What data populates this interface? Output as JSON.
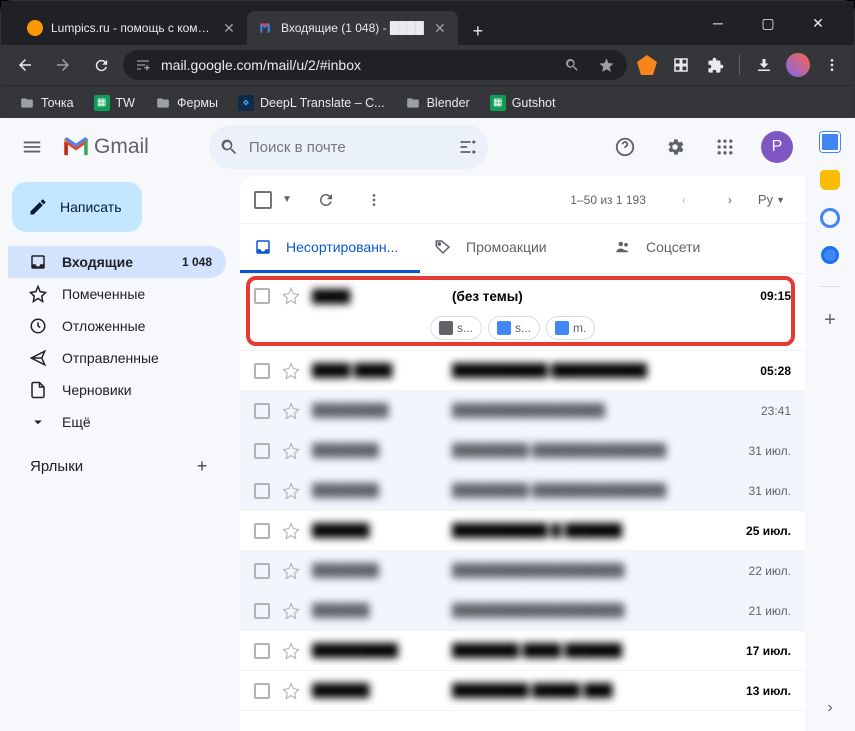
{
  "browser": {
    "tabs": [
      {
        "title": "Lumpics.ru - помощь с компью",
        "favicon": "#ff9800",
        "active": false
      },
      {
        "title": "Входящие (1 048) - ████",
        "favicon": "gmail",
        "active": true
      }
    ],
    "url": "mail.googlе.com/mail/u/2/#inbox",
    "bookmarks": [
      {
        "label": "Точка",
        "type": "folder"
      },
      {
        "label": "TW",
        "type": "sheet"
      },
      {
        "label": "Фермы",
        "type": "folder"
      },
      {
        "label": "DeepL Translate – С...",
        "type": "deepl"
      },
      {
        "label": "Blender",
        "type": "folder"
      },
      {
        "label": "Gutshot",
        "type": "sheet"
      }
    ]
  },
  "gmail": {
    "logo_text": "Gmail",
    "search_placeholder": "Поиск в почте",
    "compose_label": "Написать",
    "avatar_letter": "P",
    "nav": [
      {
        "icon": "inbox",
        "label": "Входящие",
        "count": "1 048",
        "active": true
      },
      {
        "icon": "star",
        "label": "Помеченные"
      },
      {
        "icon": "clock",
        "label": "Отложенные"
      },
      {
        "icon": "send",
        "label": "Отправленные"
      },
      {
        "icon": "draft",
        "label": "Черновики"
      },
      {
        "icon": "more",
        "label": "Ещё"
      }
    ],
    "labels_header": "Ярлыки",
    "pager_text": "1–50 из 1 193",
    "lang_label": "Ру",
    "categories": [
      {
        "label": "Несортированн...",
        "icon": "inbox",
        "active": true
      },
      {
        "label": "Промоакции",
        "icon": "tag"
      },
      {
        "label": "Соцсети",
        "icon": "people"
      }
    ],
    "highlighted_row": {
      "sender": "████",
      "subject": "(без темы)",
      "time": "09:15",
      "attachments": [
        {
          "type": "mail",
          "label": "s..."
        },
        {
          "type": "doc",
          "label": "s..."
        },
        {
          "type": "doc",
          "label": "m."
        }
      ]
    },
    "rows": [
      {
        "sender": "████ ████",
        "subject": "██████████ ██████████",
        "time": "05:28",
        "unread": true
      },
      {
        "sender": "████████",
        "subject": "████████████████",
        "time": "23:41",
        "unread": false
      },
      {
        "sender": "███████",
        "subject": "████████ ██████████████",
        "time": "31 июл.",
        "unread": false
      },
      {
        "sender": "███████",
        "subject": "████████ ██████████████",
        "time": "31 июл.",
        "unread": false
      },
      {
        "sender": "██████",
        "subject": "██████████ █ ██████",
        "time": "25 июл.",
        "unread": true
      },
      {
        "sender": "███████",
        "subject": "██████████████████",
        "time": "22 июл.",
        "unread": false
      },
      {
        "sender": "██████",
        "subject": "██████████████████",
        "time": "21 июл.",
        "unread": false
      },
      {
        "sender": "█████████",
        "subject": "███████ ████ ██████",
        "time": "17 июл.",
        "unread": true
      },
      {
        "sender": "██████",
        "subject": "████████ █████ ███",
        "time": "13 июл.",
        "unread": true
      }
    ]
  }
}
